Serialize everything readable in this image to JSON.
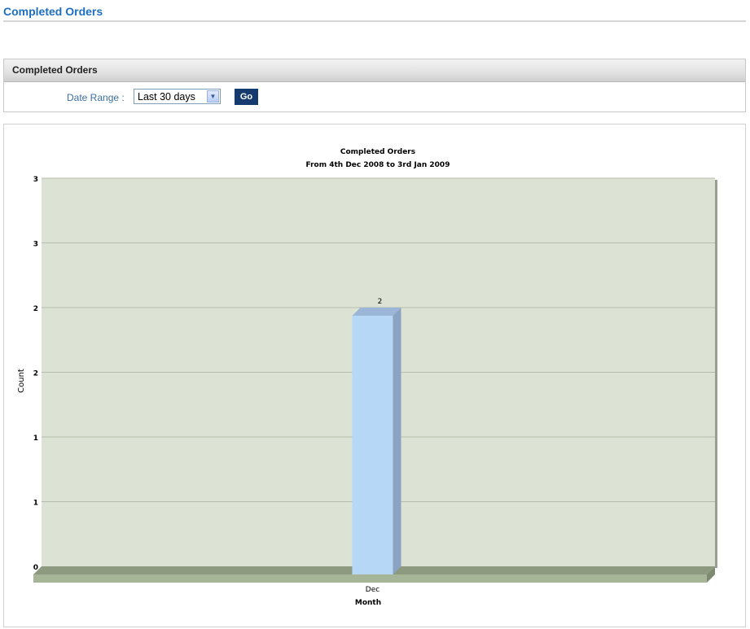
{
  "page": {
    "title": "Completed Orders"
  },
  "panel": {
    "header": "Completed Orders",
    "date_range_label": "Date Range :",
    "date_range_value": "Last 30 days",
    "go_label": "Go"
  },
  "chart_data": {
    "type": "bar",
    "title": "Completed Orders",
    "subtitle": "From 4th Dec 2008 to 3rd Jan 2009",
    "xlabel": "Month",
    "ylabel": "Count",
    "categories": [
      "Dec"
    ],
    "values": [
      2
    ],
    "data_labels": [
      "2"
    ],
    "ylim": [
      0,
      3
    ],
    "ytick_values": [
      0,
      0.5,
      1,
      1.5,
      2,
      2.5,
      3
    ],
    "ytick_labels": [
      "0",
      "1",
      "1",
      "2",
      "2",
      "3",
      "3"
    ],
    "grid": true,
    "plot_color": "#dde3d4",
    "bar_color": "#b7d7f7",
    "floor_color": "#a6b498"
  }
}
